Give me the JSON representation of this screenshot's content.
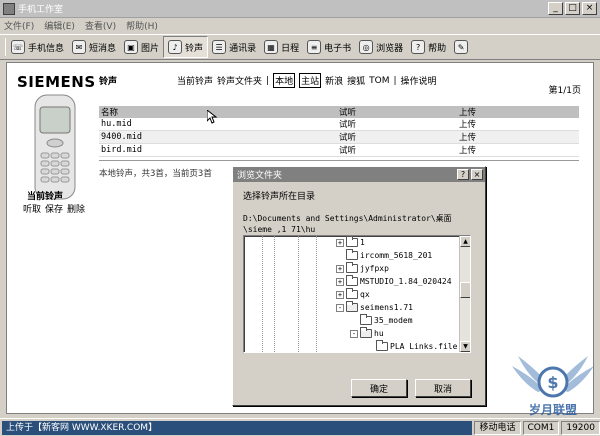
{
  "window": {
    "title": "手机工作室",
    "buttons": [
      "_",
      "□",
      "×"
    ]
  },
  "menu": [
    "文件(F)",
    "编辑(E)",
    "查看(V)",
    "帮助(H)"
  ],
  "toolbar": {
    "items": [
      {
        "label": "手机信息",
        "icon": "phone-icon"
      },
      {
        "label": "短消息",
        "icon": "message-icon"
      },
      {
        "label": "图片",
        "icon": "picture-icon"
      },
      {
        "label": "铃声",
        "icon": "ringtone-icon",
        "active": true
      },
      {
        "label": "通讯录",
        "icon": "contacts-icon"
      },
      {
        "label": "日程",
        "icon": "calendar-icon"
      },
      {
        "label": "电子书",
        "icon": "ebook-icon"
      },
      {
        "label": "浏览器",
        "icon": "browser-icon"
      },
      {
        "label": "帮助",
        "icon": "help-icon"
      }
    ]
  },
  "sidebar": {
    "brand": "SIEMENS",
    "current_label": "当前铃声",
    "actions": [
      "听取",
      "保存",
      "删除"
    ]
  },
  "main": {
    "section_title": "铃声",
    "nav": [
      {
        "label": "当前铃声",
        "boxed": false
      },
      {
        "label": "铃声文件夹",
        "boxed": false
      },
      {
        "label": "|",
        "boxed": false
      },
      {
        "label": "本地",
        "boxed": true
      },
      {
        "label": "主站",
        "boxed": true
      },
      {
        "label": "新浪",
        "boxed": false
      },
      {
        "label": "搜狐",
        "boxed": false
      },
      {
        "label": "TOM",
        "boxed": false
      },
      {
        "label": "|",
        "boxed": false
      },
      {
        "label": "操作说明",
        "boxed": false
      }
    ],
    "page_indicator": "第1/1页",
    "table": {
      "headers": [
        "名称",
        "试听",
        "上传"
      ],
      "rows": [
        [
          "hu.mid",
          "试听",
          "上传"
        ],
        [
          "9400.mid",
          "试听",
          "上传"
        ],
        [
          "bird.mid",
          "试听",
          "上传"
        ]
      ]
    },
    "summary": "本地铃声，共3首，当前页3首"
  },
  "dialog": {
    "title": "浏览文件夹",
    "title_buttons": [
      "?",
      "×"
    ],
    "prompt": "选择铃声所在目录",
    "path_line1": "D:\\Documents and Settings\\Administrator\\桌面",
    "path_line2": "\\sieme  ,1 71\\hu",
    "tree": [
      {
        "label": "1",
        "expander": "+"
      },
      {
        "label": "ircomm_5618_201",
        "expander": ""
      },
      {
        "label": "jyfpxp",
        "expander": "+"
      },
      {
        "label": "MSTUDIO_1.84_020424",
        "expander": "+"
      },
      {
        "label": "qx",
        "expander": "+"
      },
      {
        "label": "seimens1.71",
        "expander": "-"
      },
      {
        "label": "35_modem",
        "expander": ""
      },
      {
        "label": "hu",
        "expander": "-"
      },
      {
        "label": "PLA Links.file",
        "expander": ""
      }
    ],
    "ok_label": "确定",
    "cancel_label": "取消"
  },
  "status": {
    "left": "上传于【新客网 WWW.XKER.COM】",
    "cells": [
      "移动电话",
      "COM1",
      "19200"
    ]
  },
  "watermark": {
    "text": "岁月联盟"
  }
}
